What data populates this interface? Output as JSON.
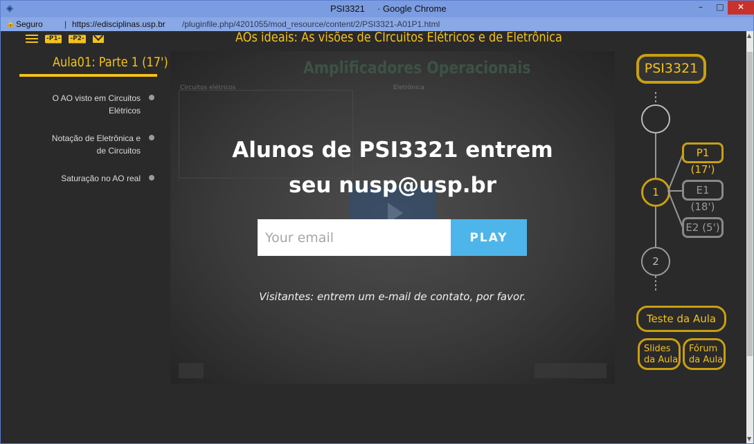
{
  "window": {
    "title": "PSI3321",
    "app_suffix": "· Google Chrome",
    "minimize": "–",
    "maximize": "□",
    "close": "✕"
  },
  "address_bar": {
    "secure_label": "Seguro",
    "separator": "|",
    "host": "https://edisciplinas.usp.br",
    "path": "/pluginfile.php/4201055/mod_resource/content/2/PSI3321-A01P1.html"
  },
  "toolbar": {
    "p1_label": "-P1-",
    "p2_label": "-P2-"
  },
  "main_title": "AOs ideais: As visões de CIrcuitos Elétricos e de Eletrônica",
  "lesson": {
    "title": "Aula01: Parte 1 (17')",
    "items": [
      {
        "label_line1": "O AO visto em Circuitos",
        "label_line2": "Elétricos"
      },
      {
        "label_line1": "Notação de Eletrônica e",
        "label_line2": "de Circuitos"
      },
      {
        "label_line1": "Saturação no AO real",
        "label_line2": ""
      }
    ]
  },
  "video": {
    "bg_title": "Amplificadores Operacionais",
    "bg_label_left": "Circuitos elétricos",
    "bg_label_right": "Eletrônica",
    "headline_line1": "Alunos de PSI3321 entrem",
    "headline_line2": "seu nusp@usp.br",
    "email_placeholder": "Your email",
    "play_label": "PLAY",
    "visitor_note": "Visitantes: entrem um e-mail de contato, por favor."
  },
  "nav": {
    "course": "PSI3321",
    "node1": "1",
    "node2": "2",
    "branch_p1": "P1 (17')",
    "branch_e1": "E1 (18')",
    "branch_e2": "E2 (5')",
    "test_button": "Teste da Aula",
    "slides_line1": "Slides",
    "slides_line2": "da Aula",
    "forum_line1": "Fórum",
    "forum_line2": "da Aula"
  },
  "colors": {
    "accent": "#f4c21a",
    "play": "#4db5ea",
    "titlebar": "#7b9ce0"
  }
}
